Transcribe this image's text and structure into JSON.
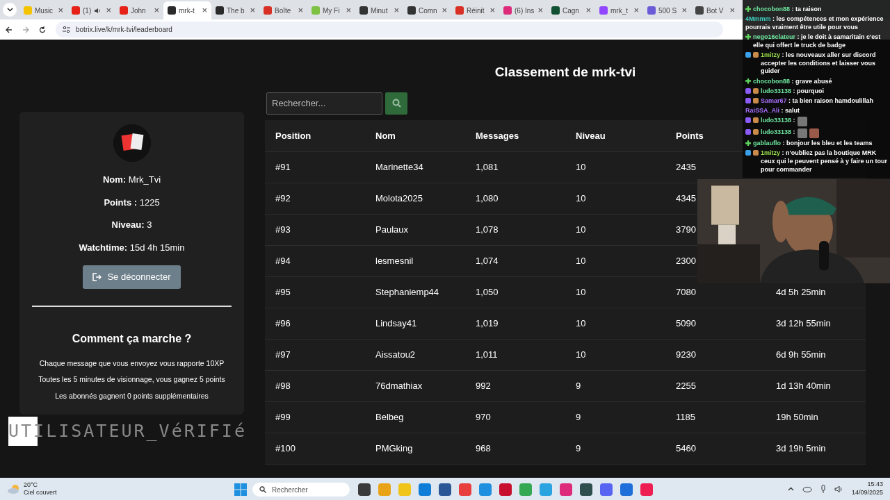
{
  "browser": {
    "tabs": [
      {
        "title": "Music",
        "color": "#f5c400",
        "selected": false,
        "audio": false,
        "close": "×"
      },
      {
        "title": "(1)",
        "color": "#e62117",
        "selected": false,
        "audio": true,
        "close": "×"
      },
      {
        "title": "John",
        "color": "#e62117",
        "selected": false,
        "audio": false,
        "close": "×"
      },
      {
        "title": "mrk-t",
        "color": "#2a2a2a",
        "selected": true,
        "audio": false,
        "close": "×"
      },
      {
        "title": "The b",
        "color": "#2a2a2a",
        "selected": false,
        "audio": false,
        "close": "×"
      },
      {
        "title": "Boîte",
        "color": "#d93025",
        "selected": false,
        "audio": false,
        "close": "×"
      },
      {
        "title": "My Fi",
        "color": "#7dc242",
        "selected": false,
        "audio": false,
        "close": "×"
      },
      {
        "title": "Minut",
        "color": "#333333",
        "selected": false,
        "audio": false,
        "close": "×"
      },
      {
        "title": "Comn",
        "color": "#333333",
        "selected": false,
        "audio": false,
        "close": "×"
      },
      {
        "title": "Réinit",
        "color": "#d93025",
        "selected": false,
        "audio": false,
        "close": "×"
      },
      {
        "title": "(6) Ins",
        "color": "#dd2a7b",
        "selected": false,
        "audio": false,
        "close": "×"
      },
      {
        "title": "Cagn",
        "color": "#0f5132",
        "selected": false,
        "audio": false,
        "close": "×"
      },
      {
        "title": "mrk_t",
        "color": "#9146ff",
        "selected": false,
        "audio": false,
        "close": "×"
      },
      {
        "title": "500 S",
        "color": "#6b5bd6",
        "selected": false,
        "audio": false,
        "close": "×"
      },
      {
        "title": "Bot V",
        "color": "#444444",
        "selected": false,
        "audio": false,
        "close": "×"
      }
    ],
    "url": "botrix.live/k/mrk-tvi/leaderboard"
  },
  "page": {
    "title": "Classement de mrk-tvi",
    "search": {
      "placeholder": "Rechercher..."
    },
    "profile": {
      "fields": [
        {
          "label": "Nom:",
          "value": "Mrk_Tvi"
        },
        {
          "label": "Points :",
          "value": "1225"
        },
        {
          "label": "Niveau:",
          "value": "3"
        },
        {
          "label": "Watchtime:",
          "value": "15d 4h 15min"
        }
      ],
      "logout": "Se déconnecter",
      "help_title": "Comment ça marche ?",
      "help_lines": [
        "Chaque message que vous envoyez vous rapporte 10XP",
        "Toutes les 5 minutes de visionnage, vous gagnez 5 points",
        "Les abonnés gagnent 0 points supplémentaires"
      ]
    },
    "table": {
      "columns": [
        "Position",
        "Nom",
        "Messages",
        "Niveau",
        "Points"
      ],
      "rows": [
        [
          "#91",
          "Marinette34",
          "1,081",
          "10",
          "2435",
          null
        ],
        [
          "#92",
          "Molota2025",
          "1,080",
          "10",
          "4345",
          null
        ],
        [
          "#93",
          "Paulaux",
          "1,078",
          "10",
          "3790",
          null
        ],
        [
          "#94",
          "lesmesnil",
          "1,074",
          "10",
          "2300",
          null
        ],
        [
          "#95",
          "Stephaniemp44",
          "1,050",
          "10",
          "7080",
          "4d 5h 25min"
        ],
        [
          "#96",
          "Lindsay41",
          "1,019",
          "10",
          "5090",
          "3d 12h 55min"
        ],
        [
          "#97",
          "Aissatou2",
          "1,011",
          "10",
          "9230",
          "6d 9h 55min"
        ],
        [
          "#98",
          "76dmathiax",
          "992",
          "9",
          "2255",
          "1d 13h 40min"
        ],
        [
          "#99",
          "Belbeg",
          "970",
          "9",
          "1185",
          "19h 50min"
        ],
        [
          "#100",
          "PMGking",
          "968",
          "9",
          "5460",
          "3d 19h 5min"
        ]
      ]
    }
  },
  "overlay": {
    "badge": "UTILISATEUR_VéRIFIé"
  },
  "chat": [
    {
      "user": "chocobon88",
      "color": "#6ee7a0",
      "badges": [
        {
          "kind": "plus"
        }
      ],
      "text": ": ta raison"
    },
    {
      "user": "4Mmmm",
      "color": "#3fd1c0",
      "text": ": les compétences et mon expérience pourrais vraiment être utile pour vous"
    },
    {
      "user": "nego16clateur",
      "color": "#6ee7a0",
      "badges": [
        {
          "kind": "plus"
        }
      ],
      "text": ": je le doit à samaritain c'est elle qui offert le truck de badge"
    },
    {
      "user": "1mitzy",
      "color": "#9be04a",
      "badges": [
        {
          "kind": "cube"
        },
        {
          "kind": "heart"
        }
      ],
      "text": ": les nouveaux aller sur discord accepter les conditions et laisser vous guider"
    },
    {
      "user": "chocobon88",
      "color": "#6ee7a0",
      "badges": [
        {
          "kind": "plus"
        }
      ],
      "text": ": grave abusé"
    },
    {
      "user": "ludo33138",
      "color": "#6ee7a0",
      "badges": [
        {
          "kind": "sub"
        },
        {
          "kind": "heart"
        }
      ],
      "text": ": pourquoi"
    },
    {
      "user": "Samar67",
      "color": "#a970ff",
      "badges": [
        {
          "kind": "sub"
        },
        {
          "kind": "heart"
        }
      ],
      "text": ": ta bien raison hamdoulillah"
    },
    {
      "user": "RaiSSA_Ali",
      "color": "#a970ff",
      "text": ": salut"
    },
    {
      "user": "ludo33138",
      "color": "#6ee7a0",
      "badges": [
        {
          "kind": "sub"
        },
        {
          "kind": "heart"
        }
      ],
      "text": ":",
      "emotes": [
        {
          "kind": "emote"
        }
      ]
    },
    {
      "user": "ludo33138",
      "color": "#6ee7a0",
      "badges": [
        {
          "kind": "sub"
        },
        {
          "kind": "heart"
        }
      ],
      "text": ":",
      "emotes": [
        {
          "kind": "emote"
        },
        {
          "kind": "emote"
        }
      ]
    },
    {
      "user": "gablauflo",
      "color": "#6ee7a0",
      "badges": [
        {
          "kind": "plus"
        }
      ],
      "text": ": bonjour les bleu et les teams"
    },
    {
      "user": "1mitzy",
      "color": "#9be04a",
      "badges": [
        {
          "kind": "cube"
        },
        {
          "kind": "heart"
        }
      ],
      "text": ": n'oubliez pas la boutique MRK ceux qui le peuvent pensé à y faire un tour pour commander"
    }
  ],
  "taskbar": {
    "weather": {
      "temp": "20°C",
      "sky": "Ciel couvert"
    },
    "search": {
      "placeholder": "Rechercher"
    },
    "apps": [
      {
        "color": "#3a3a3a"
      },
      {
        "color": "#e8a317"
      },
      {
        "color": "#f0c419"
      },
      {
        "color": "#0f7dd8"
      },
      {
        "color": "#2b5797"
      },
      {
        "color": "#e83e3e"
      },
      {
        "color": "#1f8fe0"
      },
      {
        "color": "#c8102e"
      },
      {
        "color": "#34a853"
      },
      {
        "color": "#2aa3e0"
      },
      {
        "color": "#dd2a7b"
      },
      {
        "color": "#2f4f4f"
      },
      {
        "color": "#5865f2"
      },
      {
        "color": "#1e6fd9"
      },
      {
        "color": "#ee1d52"
      }
    ],
    "time": "15:43",
    "date": "14/09/2025"
  }
}
